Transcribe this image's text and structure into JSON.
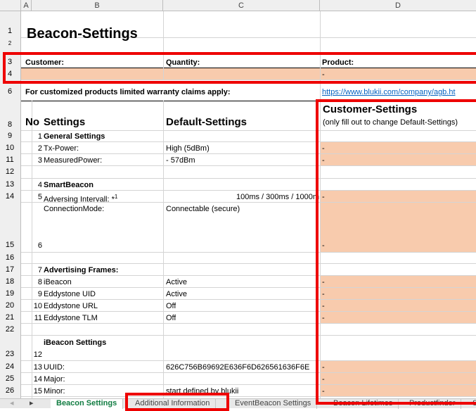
{
  "columns": [
    "A",
    "B",
    "C",
    "D"
  ],
  "row_numbers": {
    "r1": "1",
    "r2": "2",
    "r3": "3",
    "r4": "4",
    "r6": "6",
    "r8": "8",
    "r9": "9",
    "r10": "10",
    "r11": "11",
    "r12": "12",
    "r13": "13",
    "r14": "14",
    "r15": "15",
    "r16": "16",
    "r17": "17",
    "r18": "18",
    "r19": "19",
    "r20": "20",
    "r21": "21",
    "r22": "22",
    "r23": "23",
    "r24": "24",
    "r25": "25",
    "r26": "26"
  },
  "sheet": {
    "title": "Beacon-Settings",
    "customer_label": "Customer:",
    "quantity_label": "Quantity:",
    "product_label": "Product:",
    "product_value": "-",
    "warranty_text": "For customized products limited warranty claims apply:",
    "warranty_link": "https://www.blukii.com/company/agb.ht",
    "headers": {
      "no": "No",
      "settings": "Settings",
      "default": "Default-Settings",
      "customer": "Customer-Settings",
      "customer_note": "(only fill out to change Default-Settings)"
    },
    "rows": {
      "r9": {
        "no": "1",
        "setting": "General Settings",
        "default": "",
        "customer": ""
      },
      "r10": {
        "no": "2",
        "setting": "Tx-Power:",
        "default": "High (5dBm)",
        "customer": "-"
      },
      "r11": {
        "no": "3",
        "setting": "MeasuredPower:",
        "default": "- 57dBm",
        "customer": "-"
      },
      "r13": {
        "no": "4",
        "setting": "SmartBeacon",
        "default": "",
        "customer": ""
      },
      "r14": {
        "no": "5",
        "setting": "Adversing Intervall: *",
        "sup": "1",
        "default": "100ms / 300ms / 1000m",
        "customer": "-"
      },
      "r15": {
        "no": "6",
        "setting": "ConnectionMode:",
        "default": "Connectable (secure)",
        "customer": "-"
      },
      "r17": {
        "no": "7",
        "setting": "Advertising Frames:",
        "default": "",
        "customer": ""
      },
      "r18": {
        "no": "8",
        "setting": "iBeacon",
        "default": "Active",
        "customer": "-"
      },
      "r19": {
        "no": "9",
        "setting": "Eddystone UID",
        "default": "Active",
        "customer": "-"
      },
      "r20": {
        "no": "10",
        "setting": "Eddystone URL",
        "default": "Off",
        "customer": "-"
      },
      "r21": {
        "no": "11",
        "setting": "Eddystone TLM",
        "default": "Off",
        "customer": "-"
      },
      "r23": {
        "no": "12",
        "setting": "iBeacon Settings",
        "default": "",
        "customer": ""
      },
      "r24": {
        "no": "13",
        "setting": "UUID:",
        "default": "626C756B69692E636F6D626561636F6E",
        "customer": "-"
      },
      "r25": {
        "no": "14",
        "setting": "Major:",
        "default": "",
        "customer": "-"
      },
      "r26": {
        "no": "15",
        "setting": "Minor:",
        "default": "start defined by blukii",
        "customer": "-"
      }
    }
  },
  "tabs": {
    "nav_prev": "◂",
    "nav_next": "▸",
    "items": [
      "Beacon Settings",
      "Additional Information",
      "EventBeacon Settings",
      "Beacon Lifetimes",
      "Productfinder",
      "S"
    ]
  },
  "colors": {
    "accent_red": "#ee0000",
    "input_fill": "#f8cbad",
    "active_tab": "#107c41"
  }
}
